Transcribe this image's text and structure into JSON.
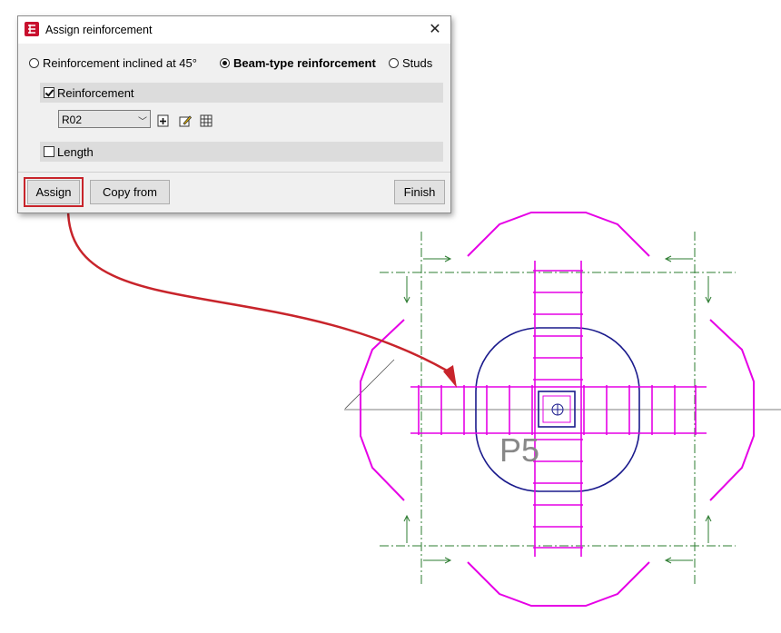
{
  "dialog": {
    "title": "Assign reinforcement",
    "close_icon": "close-icon",
    "app_icon": "app-logo-icon",
    "reinforcement_type": {
      "options": [
        {
          "label": "Reinforcement inclined at 45°",
          "selected": false
        },
        {
          "label": "Beam-type reinforcement",
          "selected": true
        },
        {
          "label": "Studs",
          "selected": false
        }
      ]
    },
    "reinforcement_group": {
      "label": "Reinforcement",
      "checked": true,
      "selected_value": "R02",
      "tool_icons": [
        "add-icon",
        "edit-pencil-icon",
        "table-grid-icon"
      ]
    },
    "length_group": {
      "label": "Length",
      "checked": false
    },
    "buttons": {
      "assign": "Assign",
      "copy_from": "Copy from",
      "finish": "Finish"
    }
  },
  "drawing": {
    "column_label": "P5",
    "colors": {
      "reinforcement": "#e600e6",
      "column_outline": "#1a1a8c",
      "axis": "#2e7d32",
      "highlight": "#c8242b"
    }
  }
}
